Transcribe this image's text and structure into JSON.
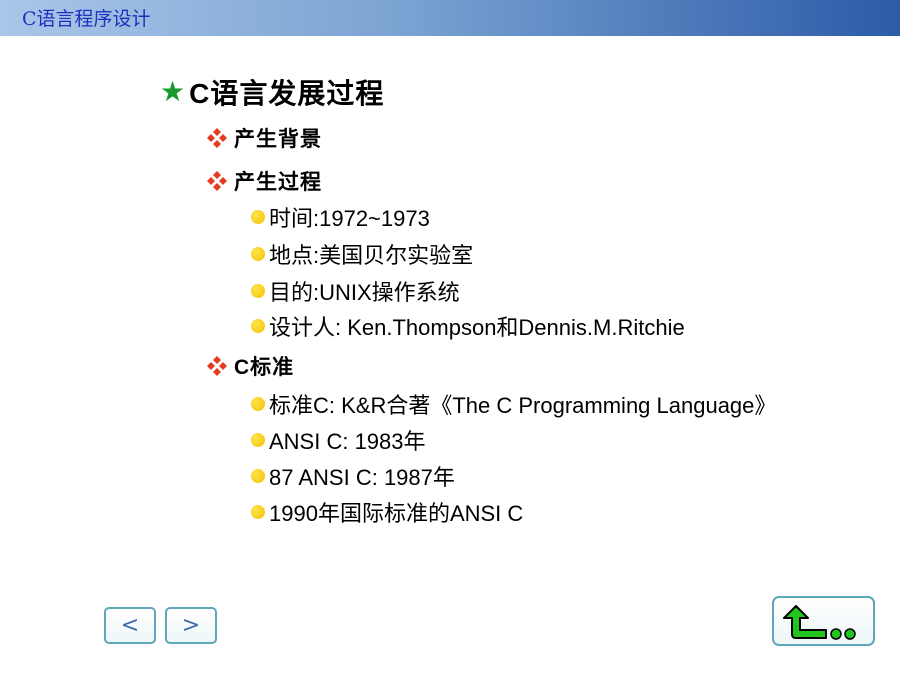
{
  "header": {
    "title": "C语言程序设计"
  },
  "heading": {
    "icon": "star-icon",
    "text": "C语言发展过程"
  },
  "sections": {
    "background": {
      "label": "产生背景"
    },
    "process": {
      "label": "产生过程",
      "items": [
        "时间:1972~1973",
        "地点:美国贝尔实验室",
        "目的:UNIX操作系统",
        "设计人: Ken.Thompson和Dennis.M.Ritchie"
      ]
    },
    "standard": {
      "label": "C标准",
      "items": [
        "标准C: K&R合著《The C Programming Language》",
        "ANSI C: 1983年",
        "87 ANSI C: 1987年",
        "1990年国际标准的ANSI C"
      ]
    }
  },
  "nav": {
    "prev_label": "<",
    "next_label": ">",
    "return_icon": "return-arrow-icon"
  },
  "colors": {
    "star": "#179a2d",
    "diamond": "#e63b1f",
    "bullet": "#f2c200",
    "header_text": "#1f2fbf",
    "button_border": "#5fa6b8",
    "return_arrow": "#22c51e"
  }
}
